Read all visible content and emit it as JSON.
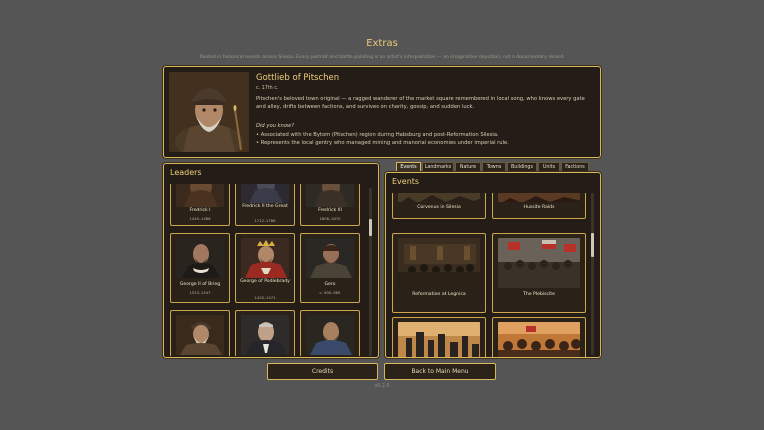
{
  "header": {
    "title": "Extras",
    "subtitle": "Rooted in historical events across Silesia. Every portrait and battle painting is an artist's interpretation — an imaginative depiction, not a documentary record."
  },
  "featured": {
    "name": "Gottlieb of Pitschen",
    "dates": "c. 17th c.",
    "description": "Pitschen's beloved town original — a ragged wanderer of the market square remembered in local song, who knows every gate and alley, drifts between factions, and survives on charity, gossip, and sudden luck.",
    "did_you_know": "Did you know?",
    "facts": [
      "• Associated with the Bytom (Pitschen) region during Habsburg and post-Reformation Silesia.",
      "• Represents the local gentry who managed mining and manorial economies under imperial rule."
    ]
  },
  "leaders": {
    "title": "Leaders",
    "cards": [
      {
        "name": "Fredrick I",
        "dates": "1440–1486"
      },
      {
        "name": "Fredrick II the Great",
        "dates": "1712–1786"
      },
      {
        "name": "Fredrick III",
        "dates": "1806–1870"
      },
      {
        "name": "George II of Brieg",
        "dates": "1523–1547"
      },
      {
        "name": "George of Podiebrady",
        "dates": "1420–1471"
      },
      {
        "name": "Gero",
        "dates": "c. 900–965"
      },
      {
        "name": "",
        "dates": ""
      },
      {
        "name": "",
        "dates": ""
      },
      {
        "name": "",
        "dates": ""
      }
    ]
  },
  "tabs": [
    "Events",
    "Landmarks",
    "Nature",
    "Towns",
    "Buildings",
    "Units",
    "Factions"
  ],
  "events": {
    "title": "Events",
    "cards": [
      {
        "name": "Corvenus in Silesia"
      },
      {
        "name": "Hussite Raids"
      },
      {
        "name": "Reformation at Legnica"
      },
      {
        "name": "The Plebiscite"
      },
      {
        "name": ""
      },
      {
        "name": ""
      }
    ]
  },
  "buttons": {
    "credits": "Credits",
    "back": "Back to Main Menu"
  },
  "version": "v0.2.0"
}
